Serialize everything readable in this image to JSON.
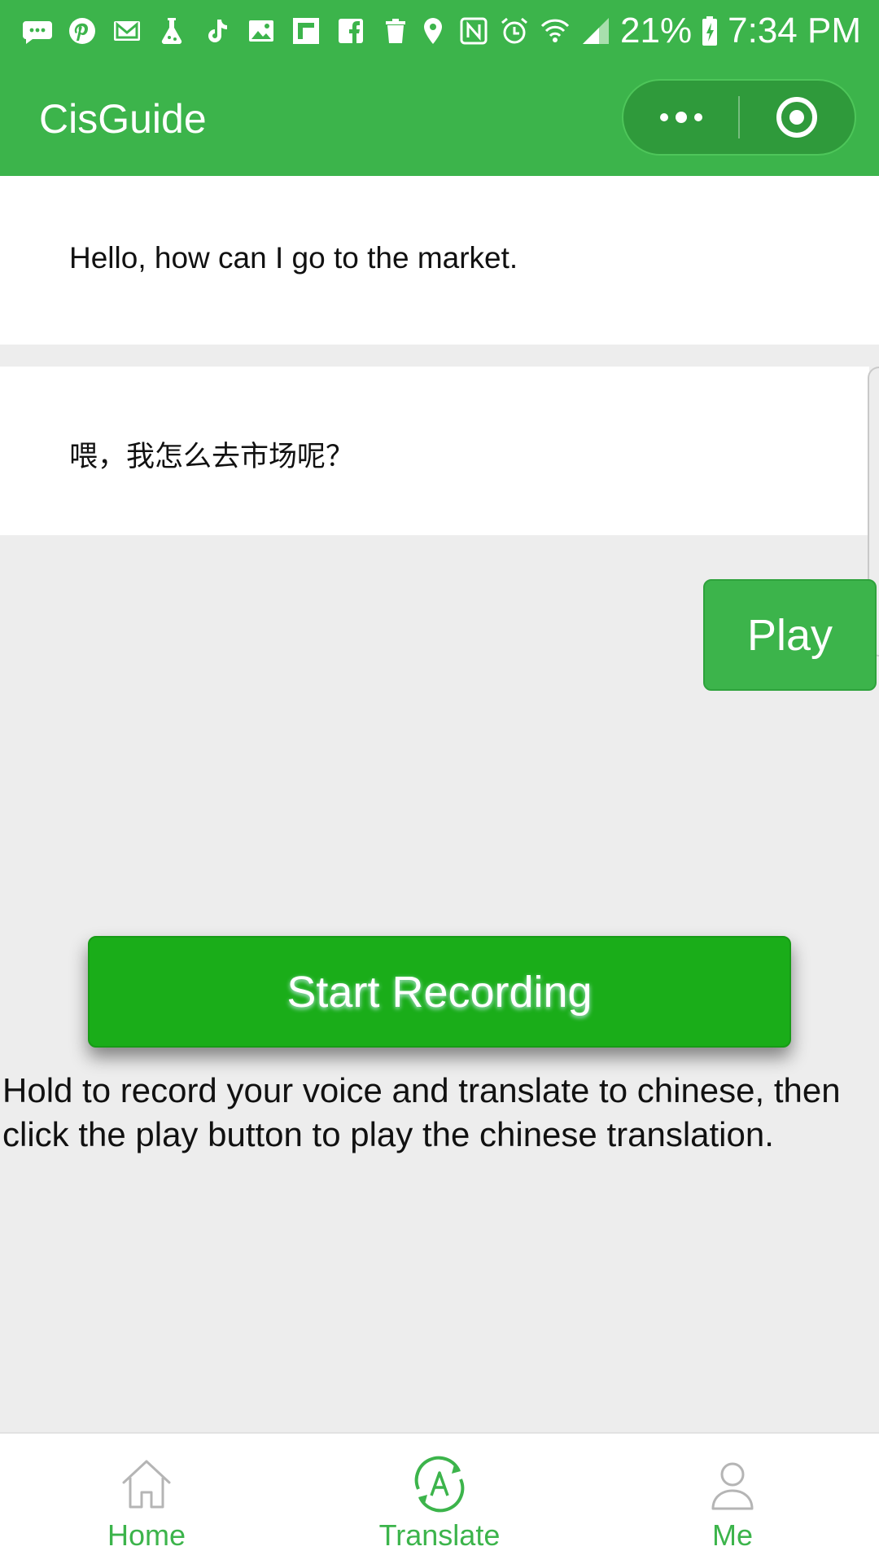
{
  "status_bar": {
    "notification_icons": [
      "messages-icon",
      "pinterest-icon",
      "gmail-icon",
      "flask-icon",
      "tiktok-icon",
      "gallery-icon",
      "flipboard-icon",
      "facebook-icon",
      "trash-icon"
    ],
    "system_icons": [
      "location-icon",
      "nfc-icon",
      "alarm-icon",
      "wifi-icon",
      "signal-icon"
    ],
    "battery": "21%",
    "time": "7:34 PM"
  },
  "nav": {
    "title": "CisGuide",
    "menu_icon": "more-dots-icon",
    "close_icon": "target-close-icon"
  },
  "source": {
    "text": "Hello, how can I go to the market."
  },
  "result": {
    "text": "喂，我怎么去市场呢？"
  },
  "play_button": {
    "label": "Play"
  },
  "record_button": {
    "label": "Start Recording"
  },
  "hint": {
    "text": "Hold to record your voice and translate to chinese, then click the play button to play the chinese translation."
  },
  "tabs": [
    {
      "label": "Home",
      "icon": "home-icon",
      "selected": false
    },
    {
      "label": "Translate",
      "icon": "translate-icon",
      "selected": true
    },
    {
      "label": "Me",
      "icon": "person-icon",
      "selected": false
    }
  ],
  "colors": {
    "brand": "#3cb44b",
    "record": "#1aad19",
    "background": "#ededed"
  }
}
